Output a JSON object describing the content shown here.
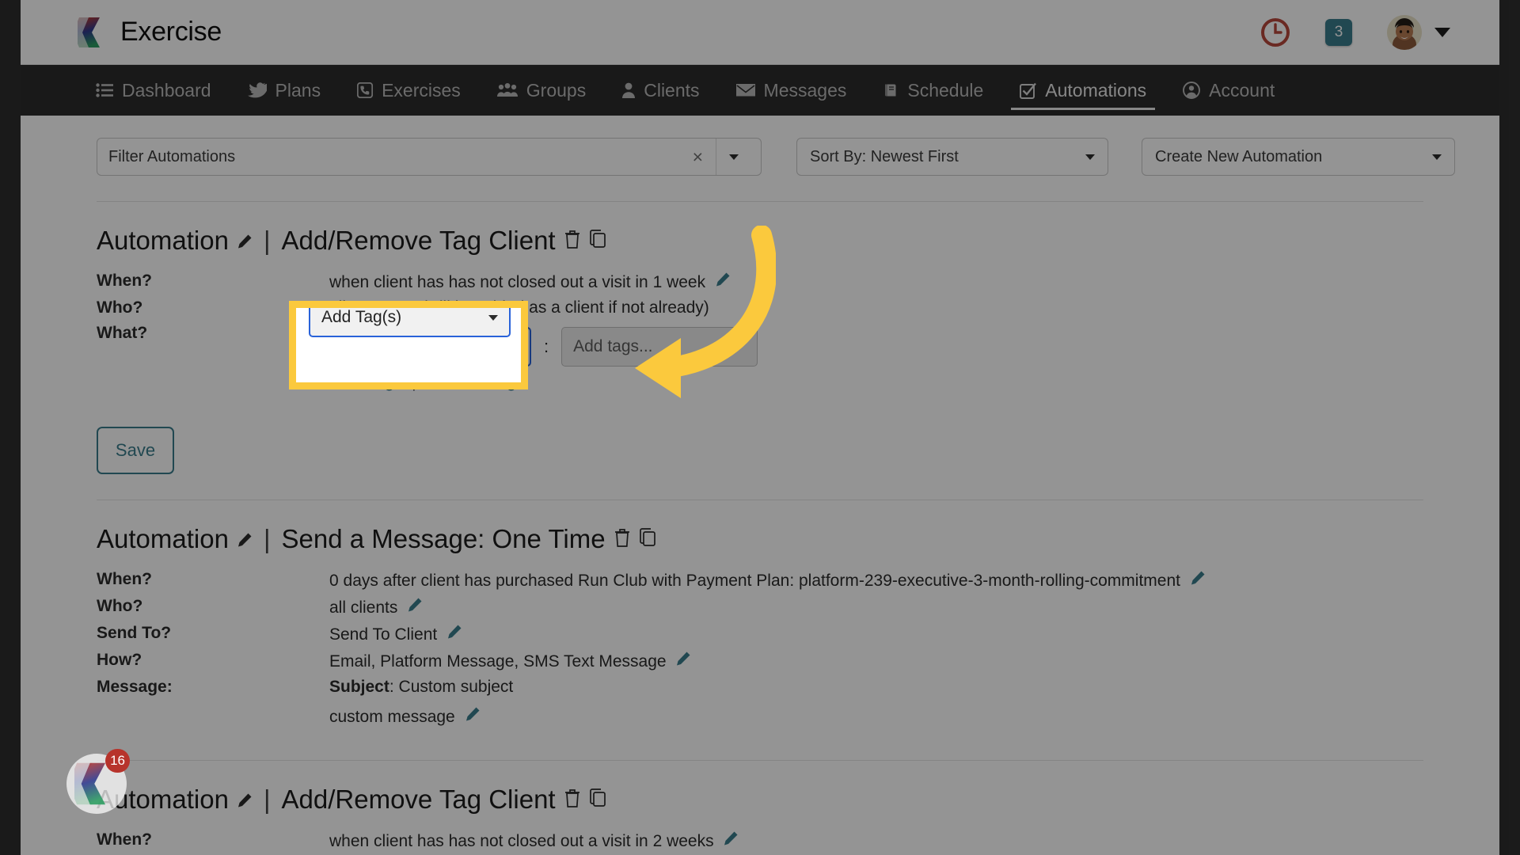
{
  "brand": {
    "name": "Exercise",
    "logo_icon": "exercise-chevrons-logo"
  },
  "topbar": {
    "clock_icon": "clock-icon",
    "clock_color": "#b7483c",
    "message_count": "3",
    "message_badge_color": "#3a7d8c",
    "avatar_icon": "user-avatar",
    "caret_icon": "chevron-down-icon"
  },
  "nav": {
    "active": "Automations",
    "items": [
      {
        "label": "Dashboard",
        "icon": "list-icon"
      },
      {
        "label": "Plans",
        "icon": "bird-icon"
      },
      {
        "label": "Exercises",
        "icon": "phone-icon"
      },
      {
        "label": "Groups",
        "icon": "people-group-icon"
      },
      {
        "label": "Clients",
        "icon": "person-icon"
      },
      {
        "label": "Messages",
        "icon": "envelope-icon"
      },
      {
        "label": "Schedule",
        "icon": "book-icon"
      },
      {
        "label": "Automations",
        "icon": "check-square-icon"
      },
      {
        "label": "Account",
        "icon": "user-circle-icon"
      }
    ]
  },
  "controls": {
    "filter_placeholder": "Filter Automations",
    "filter_value": "",
    "filter_clear_icon": "close-icon",
    "filter_caret_icon": "chevron-down-icon",
    "sort_label": "Sort By: Newest First",
    "sort_caret_icon": "chevron-down-icon",
    "create_label": "Create New Automation",
    "create_caret_icon": "chevron-down-icon"
  },
  "automations": [
    {
      "prefix": "Automation",
      "edit_icon": "pencil-icon",
      "separator": "|",
      "title": "Add/Remove Tag Client",
      "delete_icon": "trash-icon",
      "duplicate_icon": "copy-icon",
      "fields": [
        {
          "label": "When?",
          "value": "when client has has not closed out a visit in 1 week",
          "pencil": true
        },
        {
          "label": "Who?",
          "value": "all accounts (will be added as a client if not already)",
          "pencil": false
        },
        {
          "label": "What?",
          "value": "",
          "pencil": false
        }
      ],
      "editor": {
        "select_value": "Add Tag(s)",
        "select_caret_icon": "chevron-down-icon",
        "colon": ":",
        "tag_input_value": "Add tags...",
        "reset_label": "reset tags",
        "link_divider": "|",
        "done_label": "done editing"
      },
      "save_label": "Save"
    },
    {
      "prefix": "Automation",
      "edit_icon": "pencil-icon",
      "separator": "|",
      "title": "Send a Message: One Time",
      "delete_icon": "trash-icon",
      "duplicate_icon": "copy-icon",
      "fields": [
        {
          "label": "When?",
          "value": "0 days after client has purchased Run Club with Payment Plan: platform-239-executive-3-month-rolling-commitment",
          "pencil": true
        },
        {
          "label": "Who?",
          "value": "all clients",
          "pencil": true
        },
        {
          "label": "Send To?",
          "value": "Send To Client",
          "pencil": true
        },
        {
          "label": "How?",
          "value": "Email, Platform Message, SMS Text Message",
          "pencil": true
        },
        {
          "label": "Message:",
          "value": "",
          "pencil": false
        }
      ],
      "message": {
        "subject_label": "Subject",
        "subject_sep": ": ",
        "subject_value": "Custom subject",
        "body_value": "custom message",
        "pencil": true
      }
    },
    {
      "prefix": "Automation",
      "edit_icon": "pencil-icon",
      "separator": "|",
      "title": "Add/Remove Tag Client",
      "delete_icon": "trash-icon",
      "duplicate_icon": "copy-icon",
      "fields": [
        {
          "label": "When?",
          "value": "when client has has not closed out a visit in 2 weeks",
          "pencil": true
        }
      ]
    }
  ],
  "chat_widget": {
    "badge_count": "16",
    "icon": "exercise-chevrons-logo"
  },
  "highlight": {
    "color": "#fbc93d",
    "target": "add-tag-select",
    "arrow_icon": "curved-arrow-left-icon"
  }
}
